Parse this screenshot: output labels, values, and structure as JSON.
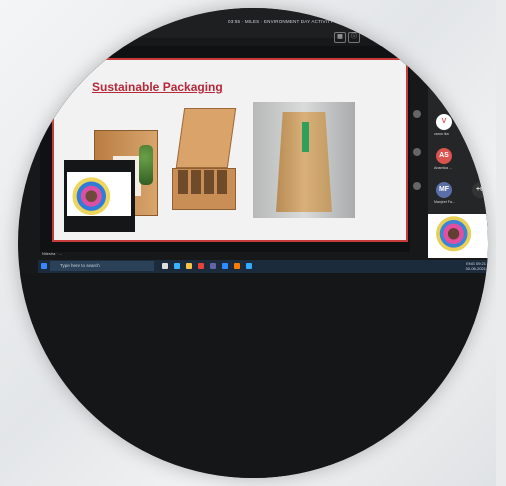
{
  "meeting": {
    "title_bar": "03:55 · MILES · ENVIRONMENT DAY ACTIVITY"
  },
  "slide": {
    "title": "Sustainable Packaging"
  },
  "participants": [
    {
      "initials": "V",
      "color": "#d9534f",
      "bg": "#ffffff",
      "label": "varun ika"
    },
    {
      "initials": "AS",
      "color": "#ffffff",
      "bg": "#d9534f",
      "label": "Anamika ..."
    },
    {
      "initials": "MF",
      "color": "#ffffff",
      "bg": "#5a6ea8",
      "label": "Manjeet Fa..."
    },
    {
      "initials": "+6",
      "color": "#e0e0e0",
      "bg": "#333333",
      "label": ""
    }
  ],
  "presenter_label": "Nilesha · ...",
  "taskbar": {
    "search_placeholder": "Type here to search",
    "time": "09:21",
    "date": "30-06-2021",
    "tray_text": "ENG"
  },
  "icons": [
    "search-icon",
    "task-view-icon",
    "edge-icon",
    "file-explorer-icon",
    "chrome-icon",
    "teams-icon",
    "zoom-icon",
    "camera-icon",
    "microphone-icon"
  ]
}
